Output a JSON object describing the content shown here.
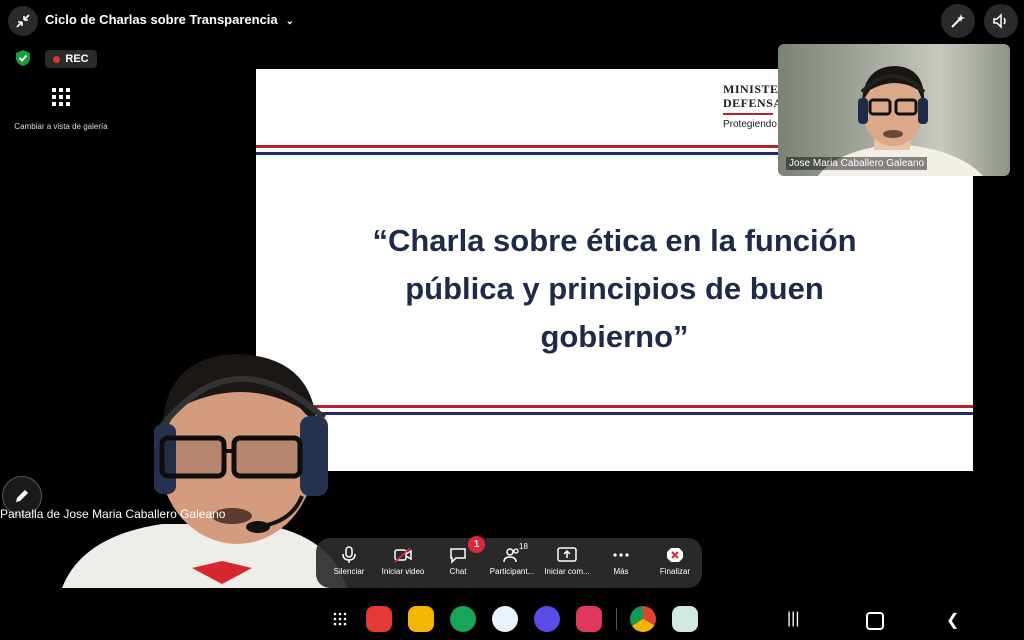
{
  "header": {
    "title": "Ciclo de Charlas sobre Transparencia"
  },
  "recording": {
    "label": "REC"
  },
  "gallery": {
    "label": "Cambiar a vista de galería"
  },
  "slide": {
    "logo_line1": "MINISTE",
    "logo_line2": "DEFENSA",
    "logo_line3": "Protegiendo",
    "title_lines": [
      "“Charla sobre ética en la función",
      "pública y principios de buen",
      "gobierno”"
    ]
  },
  "participant_thumb": {
    "name": "Jose Maria Caballero Galeano"
  },
  "screen_share": {
    "label": "Pantalla de Jose Maria Caballero Galeano"
  },
  "toolbar": {
    "mute": "Silenciar",
    "video": "Iniciar video",
    "chat": "Chat",
    "chat_badge": "1",
    "participants": "Participant...",
    "participants_count": "18",
    "share": "Iniciar com...",
    "more": "Más",
    "end": "Finalizar"
  },
  "colors": {
    "accent_red": "#e2263a",
    "slide_navy": "#1d2b48",
    "stripe_red": "#b22232",
    "stripe_blue": "#1d2b6a"
  },
  "dock_apps": [
    "apps-grid-icon",
    "flipboard-icon",
    "notes-icon",
    "phone-icon",
    "messages-icon",
    "internet-icon",
    "camera-icon",
    "chrome-icon",
    "gallery-icon"
  ]
}
